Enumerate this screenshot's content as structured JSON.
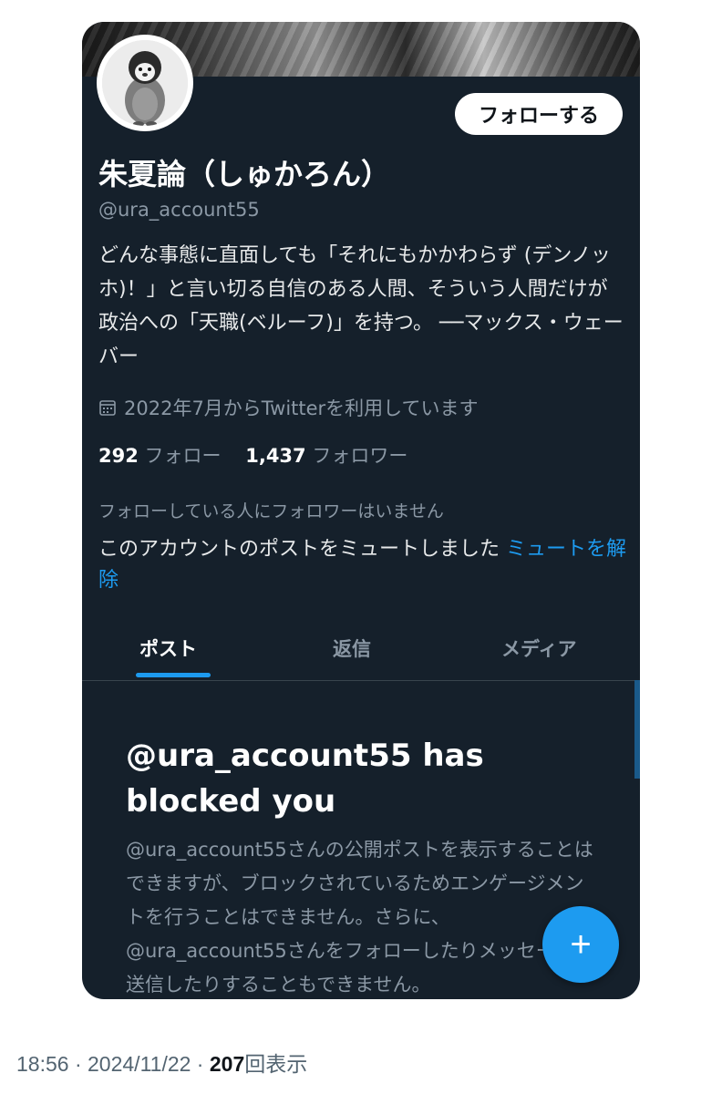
{
  "profile": {
    "follow_button": "フォローする",
    "name": "朱夏論（しゅかろん）",
    "handle": "@ura_account55",
    "bio": "どんな事態に直面しても「それにもかかわらず (デンノッホ)！」と言い切る自信のある人間、そういう人間だけが政治への「天職(ベルーフ)」を持つ。 ──マックス・ウェーバー",
    "joined": "2022年7月からTwitterを利用しています",
    "joined_icon": "calendar-icon",
    "following_count": "292",
    "following_label": "フォロー",
    "followers_count": "1,437",
    "followers_label": "フォロワー",
    "no_followers_you_know": "フォローしている人にフォロワーはいません",
    "muted_text": "このアカウントのポストをミュートしました",
    "unmute_link": "ミュートを解除"
  },
  "tabs": [
    {
      "label": "ポスト",
      "active": true
    },
    {
      "label": "返信",
      "active": false
    },
    {
      "label": "メディア",
      "active": false
    }
  ],
  "blocked": {
    "title": "@ura_account55 has blocked you",
    "description": "@ura_account55さんの公開ポストを表示することはできますが、ブロックされているためエンゲージメントを行うことはできません。さらに、@ura_account55さんをフォローしたりメッセージを送信したりすることもできません。"
  },
  "fab": {
    "icon": "plus-icon",
    "symbol": "+"
  },
  "footer": {
    "time": "18:56",
    "date": "2024/11/22",
    "views_count": "207",
    "views_label": "回表示"
  },
  "colors": {
    "background": "#15202b",
    "accent": "#1d9bf0",
    "secondary_text": "#8b98a5"
  }
}
